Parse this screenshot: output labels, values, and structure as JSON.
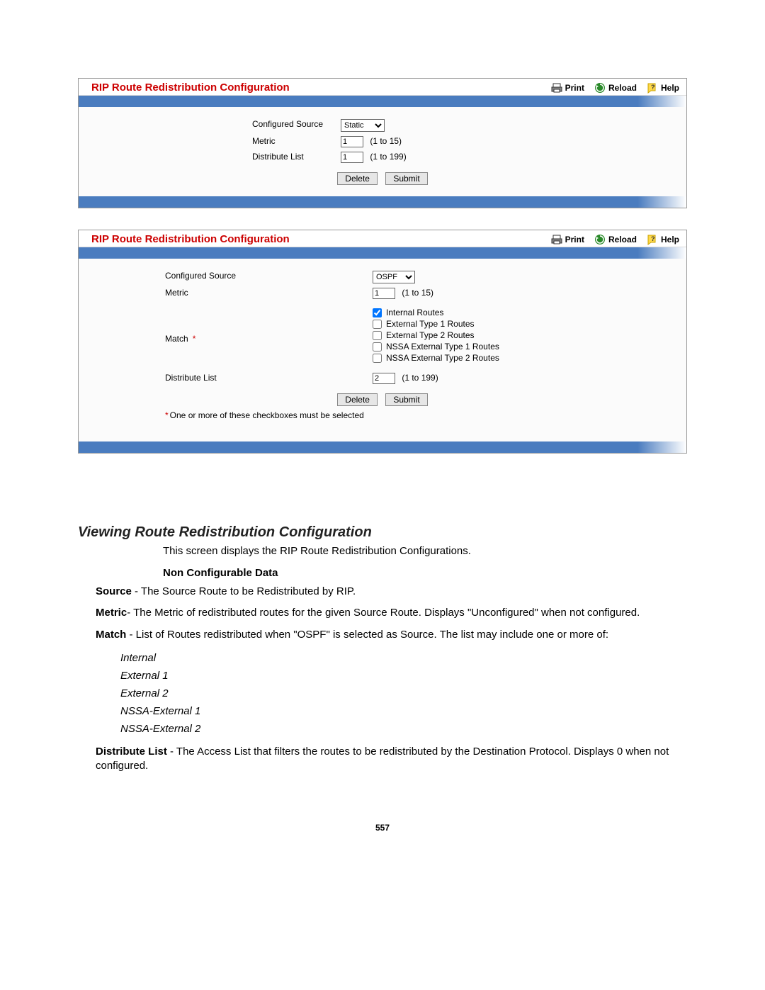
{
  "toolbar": {
    "print": "Print",
    "reload": "Reload",
    "help": "Help"
  },
  "panel1": {
    "title": "RIP Route Redistribution Configuration",
    "source_label": "Configured Source",
    "source_value": "Static",
    "metric_label": "Metric",
    "metric_value": "1",
    "metric_hint": "(1 to 15)",
    "dist_label": "Distribute List",
    "dist_value": "1",
    "dist_hint": "(1 to 199)",
    "delete_btn": "Delete",
    "submit_btn": "Submit"
  },
  "panel2": {
    "title": "RIP Route Redistribution Configuration",
    "source_label": "Configured Source",
    "source_value": "OSPF",
    "metric_label": "Metric",
    "metric_value": "1",
    "metric_hint": "(1 to 15)",
    "match_label": "Match",
    "match_star": "*",
    "match_options": [
      {
        "label": "Internal Routes",
        "checked": true
      },
      {
        "label": "External Type 1 Routes",
        "checked": false
      },
      {
        "label": "External Type 2 Routes",
        "checked": false
      },
      {
        "label": "NSSA External Type 1 Routes",
        "checked": false
      },
      {
        "label": "NSSA External Type 2 Routes",
        "checked": false
      }
    ],
    "dist_label": "Distribute List",
    "dist_value": "2",
    "dist_hint": "(1 to 199)",
    "delete_btn": "Delete",
    "submit_btn": "Submit",
    "footnote_star": "*",
    "footnote": "One or more of these checkboxes must be selected"
  },
  "doc": {
    "heading": "Viewing Route Redistribution Configuration",
    "intro": "This screen displays the RIP Route Redistribution Configurations.",
    "subhead": "Non Configurable Data",
    "source_term": "Source",
    "source_text": " - The Source Route to be Redistributed by RIP.",
    "metric_term": "Metric",
    "metric_text": "- The Metric of redistributed routes for the given Source Route. Displays \"Unconfigured\" when not configured.",
    "match_term": "Match",
    "match_text": " - List of Routes redistributed when \"OSPF\" is selected as Source. The list may include one or more of:",
    "list": [
      "Internal",
      "External 1",
      "External 2",
      "NSSA-External 1",
      "NSSA-External 2"
    ],
    "dist_term": "Distribute List",
    "dist_text": " - The Access List that filters the routes to be redistributed by the Destination Protocol. Displays 0 when not configured.",
    "page_num": "557"
  }
}
